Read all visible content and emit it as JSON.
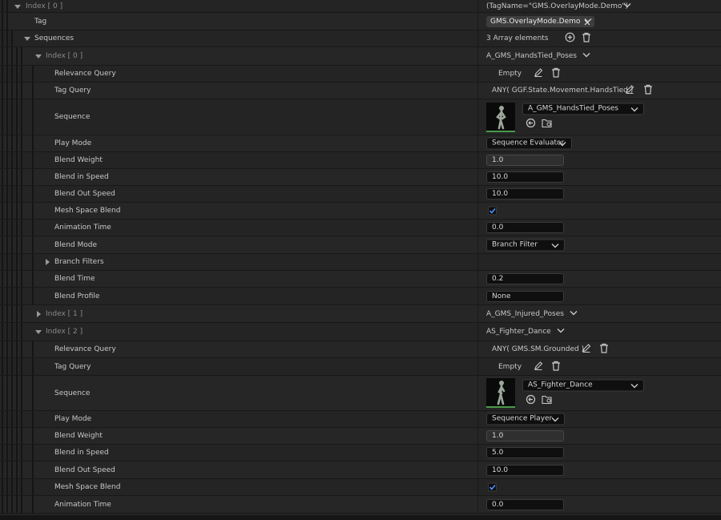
{
  "header_row": {
    "label": "Index [ 0 ]",
    "value": "(TagName=\"GMS.OverlayMode.Demo\")"
  },
  "tag_row": {
    "label": "Tag",
    "chip": "GMS.OverlayMode.Demo"
  },
  "sequences_row": {
    "label": "Sequences",
    "value": "3 Array elements"
  },
  "seq0": {
    "label": "Index [ 0 ]",
    "value": "A_GMS_HandsTied_Poses",
    "relevance_query": {
      "label": "Relevance Query",
      "value": "Empty"
    },
    "tag_query": {
      "label": "Tag Query",
      "value": "ANY( GGF.State.Movement.HandsTied )"
    },
    "sequence": {
      "label": "Sequence",
      "asset": "A_GMS_HandsTied_Poses"
    },
    "play_mode": {
      "label": "Play Mode",
      "value": "Sequence Evaluator"
    },
    "blend_weight": {
      "label": "Blend Weight",
      "value": "1.0"
    },
    "blend_in_speed": {
      "label": "Blend in Speed",
      "value": "10.0"
    },
    "blend_out_speed": {
      "label": "Blend Out Speed",
      "value": "10.0"
    },
    "mesh_space_blend": {
      "label": "Mesh Space Blend",
      "checked": true
    },
    "animation_time": {
      "label": "Animation Time",
      "value": "0.0"
    },
    "blend_mode": {
      "label": "Blend Mode",
      "value": "Branch Filter"
    },
    "branch_filters": {
      "label": "Branch Filters"
    },
    "blend_time": {
      "label": "Blend Time",
      "value": "0.2"
    },
    "blend_profile": {
      "label": "Blend Profile",
      "value": "None"
    }
  },
  "seq1": {
    "label": "Index [ 1 ]",
    "value": "A_GMS_Injured_Poses"
  },
  "seq2": {
    "label": "Index [ 2 ]",
    "value": "AS_Fighter_Dance",
    "relevance_query": {
      "label": "Relevance Query",
      "value": "ANY( GMS.SM.Grounded )"
    },
    "tag_query": {
      "label": "Tag Query",
      "value": "Empty"
    },
    "sequence": {
      "label": "Sequence",
      "asset": "AS_Fighter_Dance"
    },
    "play_mode": {
      "label": "Play Mode",
      "value": "Sequence Player"
    },
    "blend_weight": {
      "label": "Blend Weight",
      "value": "1.0"
    },
    "blend_in_speed": {
      "label": "Blend in Speed",
      "value": "5.0"
    },
    "blend_out_speed": {
      "label": "Blend Out Speed",
      "value": "10.0"
    },
    "mesh_space_blend": {
      "label": "Mesh Space Blend",
      "checked": true
    },
    "animation_time": {
      "label": "Animation Time",
      "value": "0.0"
    }
  },
  "colors": {
    "accent": "#3a86ff",
    "thumb_border": "#4a9a4a"
  }
}
